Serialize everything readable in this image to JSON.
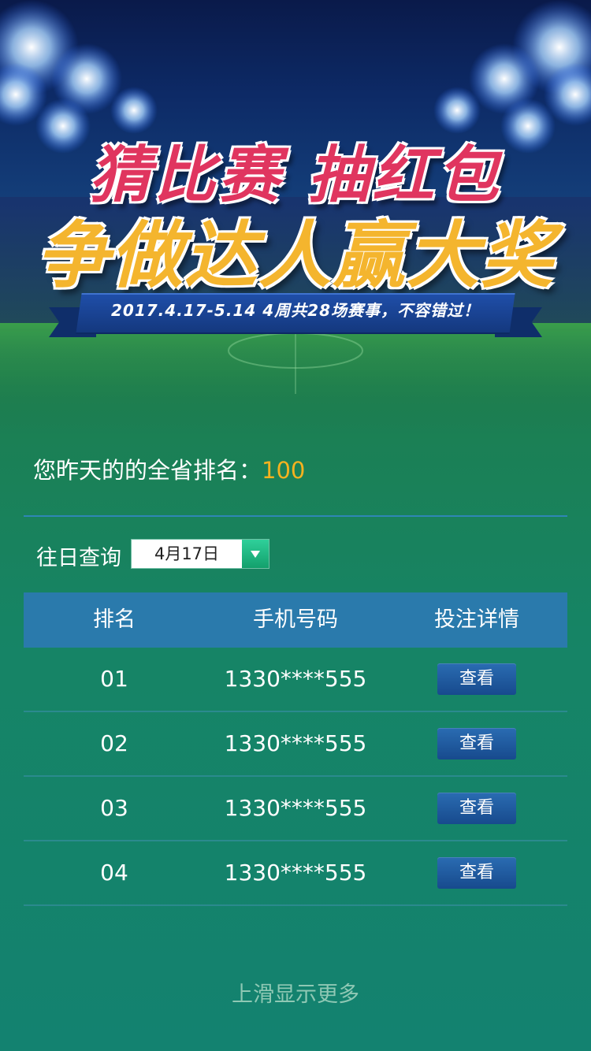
{
  "banner": {
    "title_line1": "猜比赛 抽红包",
    "title_line2": "争做达人赢大奖",
    "ribbon_text": "2017.4.17-5.14  4周共28场赛事，不容错过！"
  },
  "rank": {
    "label": "您昨天的的全省排名：",
    "value": "100"
  },
  "query": {
    "label": "往日查询",
    "selected_date": "4月17日"
  },
  "table": {
    "headers": [
      "排名",
      "手机号码",
      "投注详情"
    ],
    "rows": [
      {
        "rank": "01",
        "phone": "1330****555",
        "action": "查看"
      },
      {
        "rank": "02",
        "phone": "1330****555",
        "action": "查看"
      },
      {
        "rank": "03",
        "phone": "1330****555",
        "action": "查看"
      },
      {
        "rank": "04",
        "phone": "1330****555",
        "action": "查看"
      }
    ]
  },
  "footer": {
    "hint": "上滑显示更多"
  },
  "colors": {
    "accent": "#f5b21f",
    "header_bg": "#2a7aac",
    "button": "#1f5aa0",
    "title_pink": "#e0355f",
    "title_gold": "#f4b52e"
  }
}
